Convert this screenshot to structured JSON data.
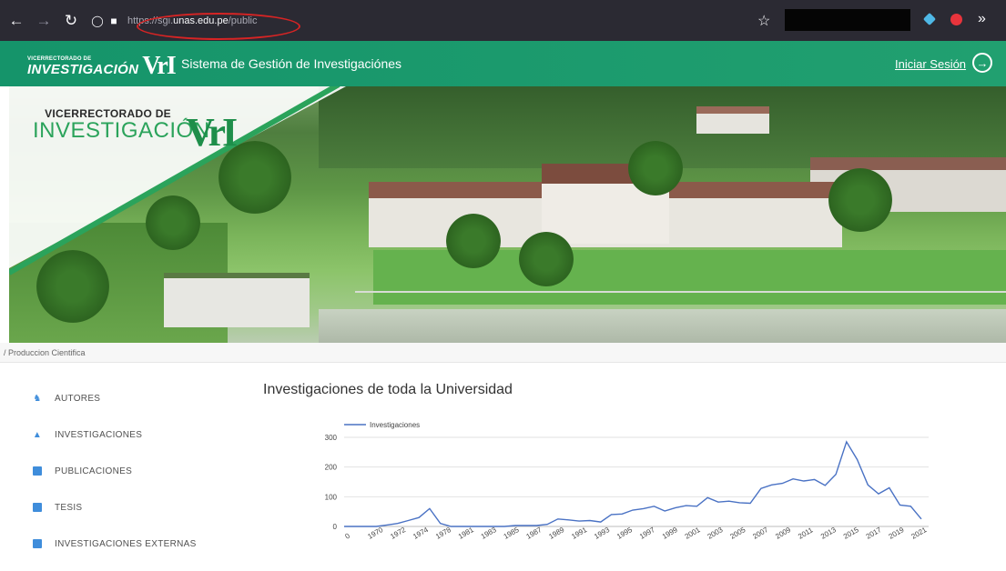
{
  "browser": {
    "url_prefix": "https://sgi.",
    "url_host": "unas.edu.pe",
    "url_path": "/public",
    "icons": [
      "back-arrow-icon",
      "forward-arrow-icon",
      "reload-icon",
      "shield-icon",
      "lock-icon",
      "star-icon",
      "overflow-icon"
    ]
  },
  "header": {
    "logo_top": "VICERRECTORADO DE",
    "logo_bottom": "INVESTIGACIÓN",
    "logo_mark": "VrI",
    "title": "Sistema de Gestión de Investigaciónes",
    "login_label": "Iniciar Sesión",
    "accent_color": "#1d9a6c"
  },
  "banner": {
    "logo_top": "VICERRECTORADO DE",
    "logo_bottom": "INVESTIGACIÓN",
    "logo_mark": "VrI"
  },
  "breadcrumb": "/ Produccion Cientifica",
  "sidebar": {
    "items": [
      {
        "label": "AUTORES",
        "icon": "users-icon"
      },
      {
        "label": "INVESTIGACIONES",
        "icon": "flask-icon"
      },
      {
        "label": "PUBLICACIONES",
        "icon": "document-icon"
      },
      {
        "label": "TESIS",
        "icon": "book-icon"
      },
      {
        "label": "INVESTIGACIONES EXTERNAS",
        "icon": "external-icon"
      }
    ]
  },
  "main": {
    "title": "Investigaciones de toda la Universidad"
  },
  "chart_data": {
    "type": "line",
    "title": "",
    "legend": "top-left",
    "series": [
      {
        "name": "Investigaciones",
        "color": "#4a72c4"
      }
    ],
    "ylim": [
      0,
      300
    ],
    "yticks": [
      0,
      100,
      200,
      300
    ],
    "xlabels": [
      "0",
      "1970",
      "1972",
      "1974",
      "1978",
      "1981",
      "1983",
      "1985",
      "1987",
      "1989",
      "1991",
      "1993",
      "1995",
      "1997",
      "1999",
      "2001",
      "2003",
      "2005",
      "2007",
      "2009",
      "2011",
      "2013",
      "2015",
      "2017",
      "2019",
      "2021"
    ],
    "values": [
      0,
      0,
      0,
      0,
      5,
      10,
      20,
      30,
      60,
      10,
      0,
      0,
      0,
      0,
      0,
      0,
      3,
      3,
      3,
      7,
      25,
      22,
      18,
      20,
      15,
      40,
      42,
      55,
      60,
      68,
      52,
      63,
      70,
      68,
      97,
      82,
      85,
      80,
      78,
      128,
      140,
      145,
      160,
      153,
      158,
      138,
      175,
      285,
      225,
      140,
      110,
      130,
      72,
      68,
      25
    ]
  }
}
